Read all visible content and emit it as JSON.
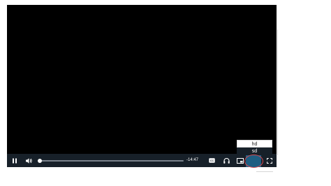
{
  "player": {
    "time_remaining": "-14:47",
    "progress_fraction": 0.01,
    "captions_label": "CC",
    "quality_options": [
      "hd",
      "sd"
    ],
    "selected_quality": "sd"
  },
  "colors": {
    "control_bar": "#172029",
    "quality_button_active": "#1e5e82",
    "annotation": "#d4484f"
  },
  "icons": {
    "pause": "pause-icon",
    "volume": "volume-icon",
    "captions": "captions-icon",
    "audio": "headphones-icon",
    "pip": "picture-in-picture-icon",
    "fullscreen": "fullscreen-icon"
  }
}
